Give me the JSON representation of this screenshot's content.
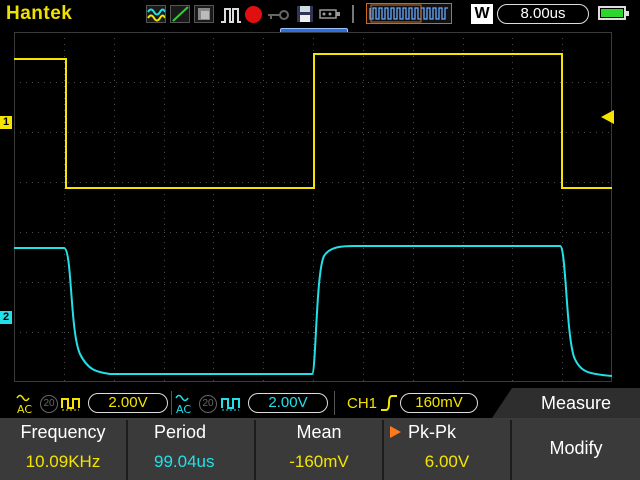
{
  "brand": "Hantek",
  "timebase": "8.00us",
  "trigger_position": "0.000s",
  "channel_markers": [
    "1",
    "2"
  ],
  "ch1": {
    "coupling": "AC",
    "bw": "20",
    "volts_div": "2.00V",
    "color": "#f4e400"
  },
  "ch2": {
    "coupling": "AC",
    "bw": "20",
    "volts_div": "2.00V",
    "color": "#22e0e8"
  },
  "trigger": {
    "source": "CH1",
    "level": "160mV"
  },
  "menu": {
    "title": "Measure",
    "modify": "Modify"
  },
  "measurements": [
    {
      "label": "Frequency",
      "value": "10.09KHz",
      "color": "#f4e400"
    },
    {
      "label": "Period",
      "value": "99.04us",
      "color": "#22e0e8"
    },
    {
      "label": "Mean",
      "value": "-160mV",
      "color": "#f4e400"
    },
    {
      "label": "Pk-Pk",
      "value": "6.00V",
      "color": "#f4e400"
    }
  ]
}
